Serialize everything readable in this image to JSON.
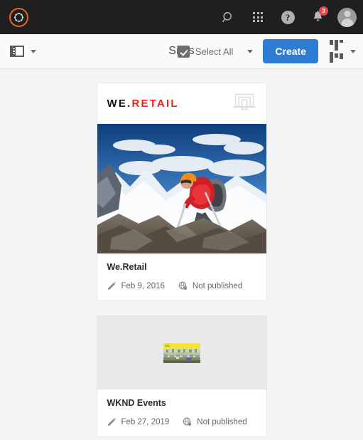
{
  "shell": {
    "logo_icon": "adobe-experience-manager-logo",
    "search_icon": "search-icon",
    "solutions_icon": "app-grid-icon",
    "help_icon": "help-icon",
    "help_glyph": "?",
    "notifications_icon": "bell-icon",
    "notifications_count": "3",
    "avatar_icon": "user-avatar-icon",
    "background_color": "#1f1f1f"
  },
  "toolbar": {
    "rail_toggle_icon": "side-rail-toggle-icon",
    "rail_chevron_icon": "chevron-down-icon",
    "title": "Sites",
    "select_all_icon": "checkbox-checked-icon",
    "select_all_label": "Select All",
    "select_all_chevron_icon": "chevron-down-icon",
    "create_label": "Create",
    "create_color": "#2e7dd4",
    "view_switch_icon": "card-view-icon",
    "view_switch_chevron_icon": "chevron-down-icon"
  },
  "cards": [
    {
      "brand_dark": "WE.",
      "brand_accent": "RETAIL",
      "brand_accent_color": "#f02311",
      "layout_icon": "responsive-layout-icon",
      "hero_icon": "mountaineer-hero-image",
      "title": "We.Retail",
      "modified_icon": "pencil-edit-icon",
      "modified_date": "Feb 9, 2016",
      "publish_icon": "globe-publish-icon",
      "publish_status": "Not published"
    },
    {
      "thumbnail_icon": "wknd-events-thumbnail",
      "title": "WKND Events",
      "modified_icon": "pencil-edit-icon",
      "modified_date": "Feb 27, 2019",
      "publish_icon": "globe-publish-icon",
      "publish_status": "Not published"
    }
  ]
}
